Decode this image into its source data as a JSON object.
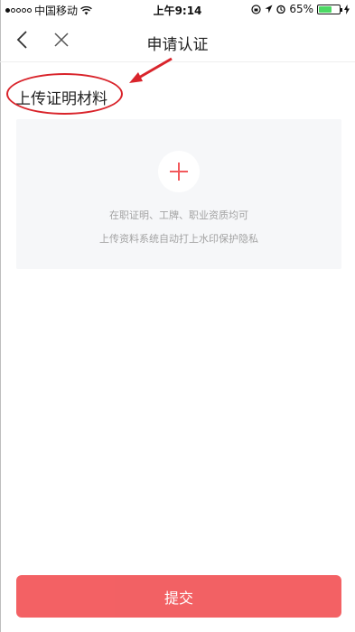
{
  "status_bar": {
    "carrier": "中国移动",
    "time": "上午9:14",
    "battery_percent": "65%",
    "battery_level": 0.65,
    "signal_bars_filled": 1
  },
  "nav": {
    "title": "申请认证",
    "back_icon": "chevron-left-icon",
    "close_icon": "close-icon"
  },
  "section": {
    "title": "上传证明材料"
  },
  "upload": {
    "icon": "plus-icon",
    "hint_line_1": "在职证明、工牌、职业资质均可",
    "hint_line_2": "上传资料系统自动打上水印保护隐私"
  },
  "submit": {
    "label": "提交"
  },
  "colors": {
    "accent": "#f2595c",
    "annotation": "#d9242b",
    "hint_text": "#a3a3a3",
    "upload_bg": "#f6f7f9"
  }
}
